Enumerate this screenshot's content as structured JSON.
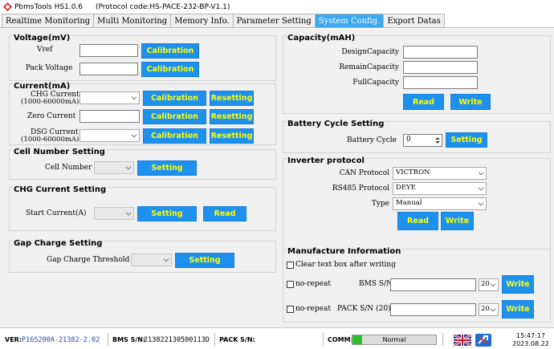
{
  "window": {
    "app_name": "PbmsTools HS1.0.6",
    "protocol_code": "(Protocol code:HS-PACE-232-BP-V1.1)"
  },
  "tabs": [
    {
      "label": "Realtime Monitoring",
      "active": false
    },
    {
      "label": "Multi Monitoring",
      "active": false
    },
    {
      "label": "Memory Info.",
      "active": false
    },
    {
      "label": "Parameter Setting",
      "active": false
    },
    {
      "label": "System Config.",
      "active": true
    },
    {
      "label": "Export Datas",
      "active": false
    }
  ],
  "voltage": {
    "title": "Voltage(mV)",
    "vref_label": "Vref",
    "vref_value": "",
    "pack_label": "Pack Voltage",
    "pack_value": "",
    "calibration": "Calibration"
  },
  "current": {
    "title": "Current(mA)",
    "chg_label_1": "CHG Current",
    "chg_label_2": "(1000-60000mA)",
    "zero_label": "Zero Current",
    "dsg_label_1": "DSG Current",
    "dsg_label_2": "(1000-60000mA)",
    "calibration": "Calibration",
    "resetting": "Resetting"
  },
  "cell_number": {
    "title": "Cell Number Setting",
    "label": "Cell Number",
    "setting": "Setting"
  },
  "chg_current": {
    "title": "CHG Current Setting",
    "label": "Start Current(A)",
    "setting": "Setting",
    "read": "Read"
  },
  "gap_charge": {
    "title": "Gap Charge Setting",
    "label": "Gap Charge Threshold",
    "setting": "Setting"
  },
  "capacity": {
    "title": "Capacity(mAH)",
    "design_label": "DesignCapacity",
    "remain_label": "RemainCapacity",
    "full_label": "FullCapacity",
    "read": "Read",
    "write": "Write"
  },
  "battery_cycle": {
    "title": "Battery Cycle Setting",
    "label": "Battery Cycle",
    "value": "0",
    "setting": "Setting"
  },
  "inverter": {
    "title": "Inverter protocol",
    "can_label": "CAN Protocol",
    "can_value": "VICTRON",
    "rs485_label": "RS485 Protocol",
    "rs485_value": "DEYE",
    "type_label": "Type",
    "type_value": "Manual",
    "read": "Read",
    "write": "Write"
  },
  "manufacture": {
    "title": "Manufacture Information",
    "clear_label": "Clear text box after writing",
    "no_repeat_label": "no-repeat",
    "bms_label": "BMS S/N",
    "pack_label": "PACK S/N (20)",
    "len_value": "20",
    "write": "Write"
  },
  "status": {
    "ver_label": "VER:",
    "ver_value": "P16S200A-21382-2.02",
    "bms_label": "BMS S/N:",
    "bms_value": "213822130500113D",
    "pack_label": "PACK S/N:",
    "comm_label": "COMM:",
    "comm_value": "Normal",
    "time": "15:47:17",
    "date": "2023.08.22"
  },
  "colors": {
    "button_bg": "#1e90ee",
    "button_text": "#ffff00",
    "active_tab": "#3aa8f0",
    "comm_ok": "#2dc02d"
  }
}
